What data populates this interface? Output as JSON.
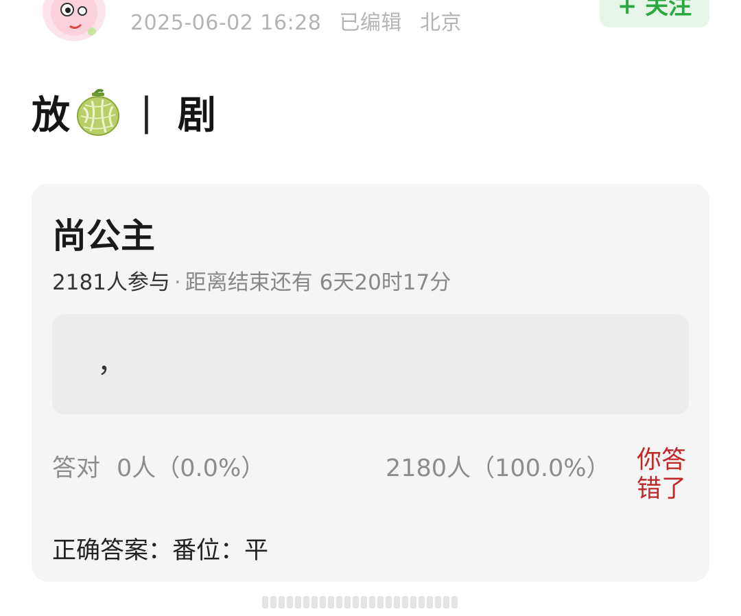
{
  "post": {
    "timestamp": "2025-06-02 16:28",
    "edited": "已编辑",
    "location": "北京",
    "follow_label": "+ 关注"
  },
  "headline": {
    "part1": "放",
    "separator": "|",
    "part2": "剧",
    "emoji_icon": "melon-icon"
  },
  "quiz": {
    "title": "尚公主",
    "participants": "2181人参与",
    "separator": "·",
    "countdown": "距离结束还有 6天20时17分",
    "option_text": "，",
    "correct_label": "答对",
    "correct_count": "0人（0.0%）",
    "wrong_count": "2180人（100.0%）",
    "result": "你答错了",
    "answer": "正确答案：番位：平"
  },
  "colors": {
    "accent_green": "#2aa83f",
    "wrong_red": "#c0282a",
    "card_bg": "#f5f5f5"
  }
}
